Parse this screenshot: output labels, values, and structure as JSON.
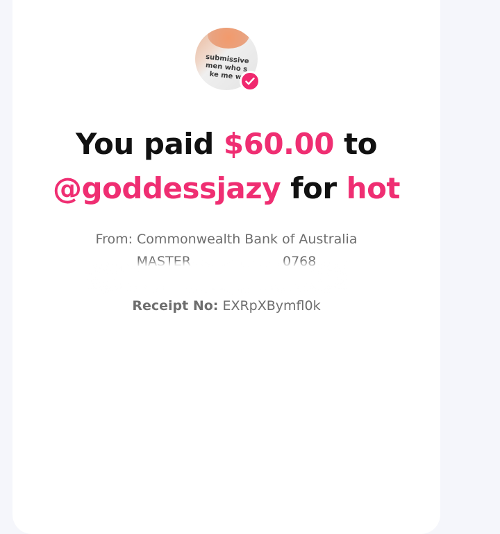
{
  "payment": {
    "prefix": "You paid",
    "amount": "$60.00",
    "to_word": "to",
    "recipient": "@goddessjazy",
    "for_word": "for",
    "item": "hot"
  },
  "source": {
    "from_text": "From: Commonwealth Bank of Australia",
    "card_partial": "MASTER",
    "card_last4": "0768"
  },
  "receipt": {
    "label": "Receipt No:",
    "number": "EXRpXBymfl0k"
  },
  "avatar": {
    "shirt_text_line1": "submissive",
    "shirt_text_line2": "men who s",
    "shirt_text_line3": "ke me w",
    "verified_icon": "check-icon"
  },
  "colors": {
    "accent": "#ef2e72",
    "badge": "#f0286e",
    "text": "#111111",
    "muted": "#6e6e6e"
  }
}
